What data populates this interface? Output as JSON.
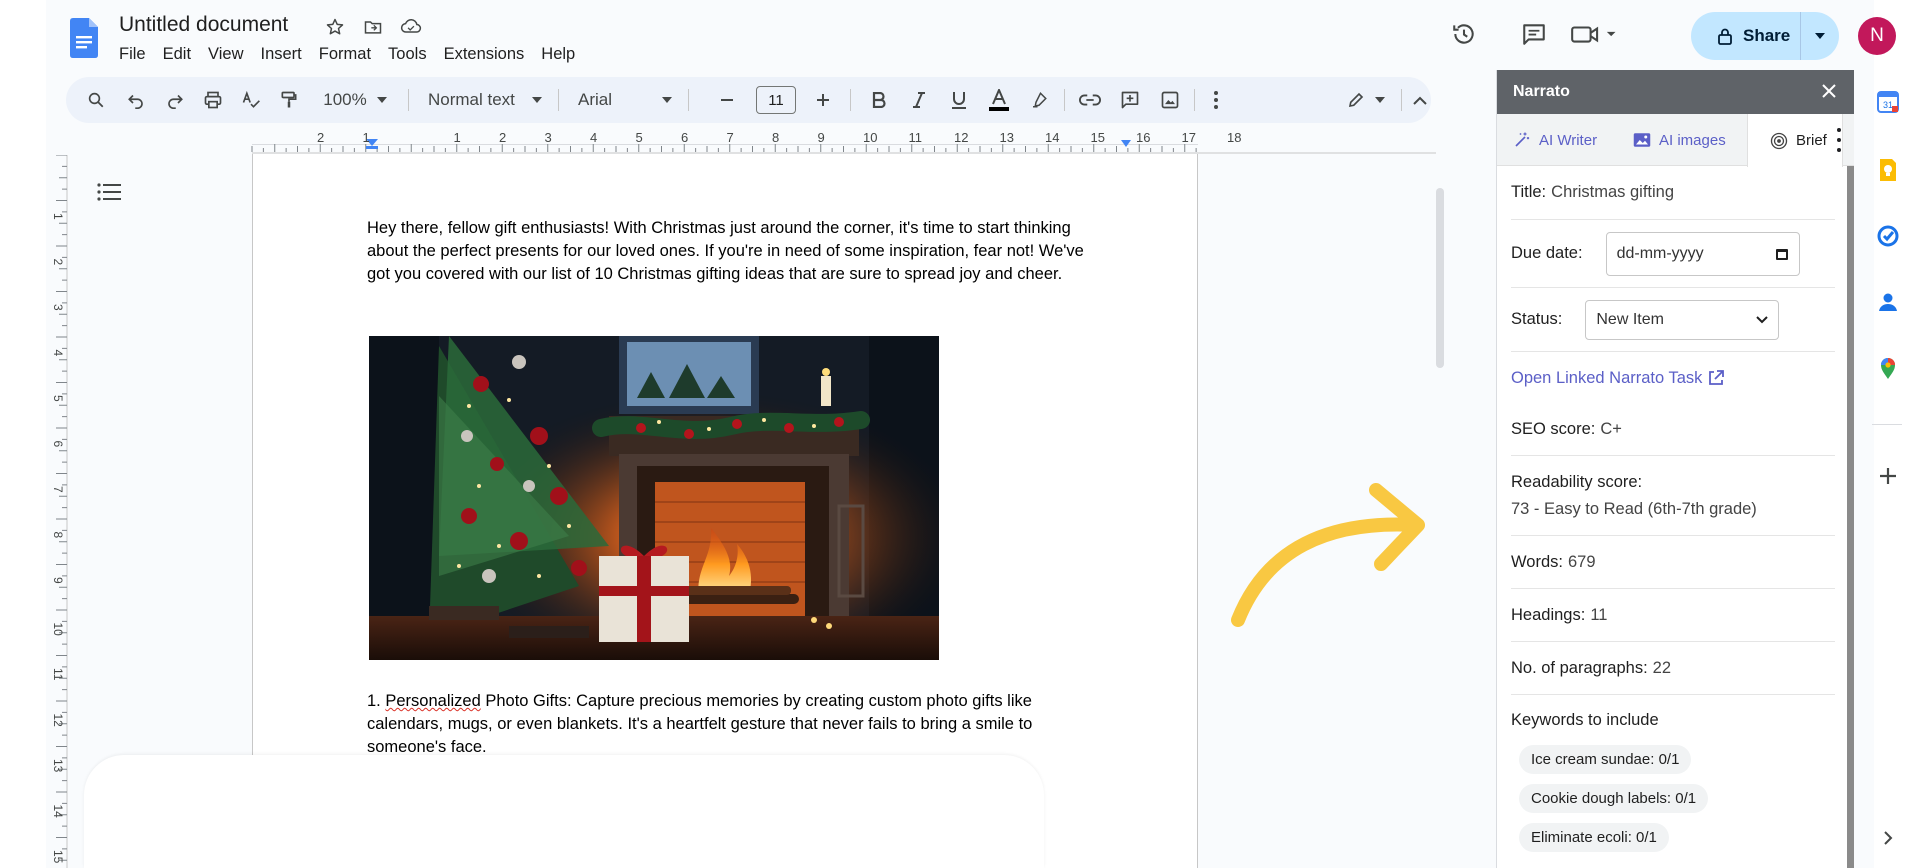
{
  "document": {
    "title": "Untitled document",
    "menu": [
      "File",
      "Edit",
      "View",
      "Insert",
      "Format",
      "Tools",
      "Extensions",
      "Help"
    ]
  },
  "share": {
    "label": "Share"
  },
  "user": {
    "avatar_letter": "N",
    "avatar_color": "#c2185b"
  },
  "toolbar": {
    "zoom": "100%",
    "style": "Normal text",
    "font": "Arial",
    "font_size": "11"
  },
  "ruler": {
    "h_labels": [
      "2",
      "1",
      "1",
      "2",
      "3",
      "4",
      "5",
      "6",
      "7",
      "8",
      "9",
      "10",
      "11",
      "12",
      "13",
      "14",
      "15",
      "16",
      "17",
      "18"
    ],
    "v_labels": [
      "1",
      "2",
      "3",
      "4",
      "5",
      "6",
      "7",
      "8",
      "9",
      "10",
      "11",
      "12",
      "13",
      "14",
      "15"
    ]
  },
  "content": {
    "intro_paragraph": "Hey there, fellow gift enthusiasts! With Christmas just around the corner, it's time to start thinking about the perfect presents for our loved ones. If you're in need of some inspiration, fear not! We've got you covered with our list of 10 Christmas gifting ideas that are sure to spread joy and cheer.",
    "item1_prefix": "1. ",
    "item1_misspelled": "Personalized",
    "item1_rest": " Photo Gifts: Capture precious memories by creating custom photo gifts like calendars, mugs, or even blankets. It's a heartfelt gesture that never fails to bring a smile to someone's face."
  },
  "panel": {
    "title": "Narrato",
    "tabs": [
      {
        "label": "AI Writer",
        "icon": "magic-wand-icon"
      },
      {
        "label": "AI images",
        "icon": "image-icon"
      },
      {
        "label": "Brief",
        "icon": "target-icon",
        "active": true
      }
    ],
    "title_label": "Title:",
    "title_value": "Christmas gifting",
    "due_date_label": "Due date:",
    "due_date_placeholder": "dd-mm-yyyy",
    "status_label": "Status:",
    "status_value": "New Item",
    "linked_task_label": "Open Linked Narrato Task",
    "seo_label": "SEO score:",
    "seo_value": "C+",
    "readability_label": "Readability score:",
    "readability_value": "73 - Easy to Read (6th-7th grade)",
    "words_label": "Words:",
    "words_value": "679",
    "headings_label": "Headings:",
    "headings_value": "11",
    "paragraphs_label": "No. of paragraphs:",
    "paragraphs_value": "22",
    "keywords_title": "Keywords to include",
    "keywords": [
      "Ice cream sundae: 0/1",
      "Cookie dough labels: 0/1",
      "Eliminate ecoli: 0/1"
    ]
  },
  "colors": {
    "accent": "#5b5fc7",
    "share_bg": "#c2e7ff",
    "annotation_arrow": "#f9c842",
    "docs_blue": "#4285f4"
  }
}
